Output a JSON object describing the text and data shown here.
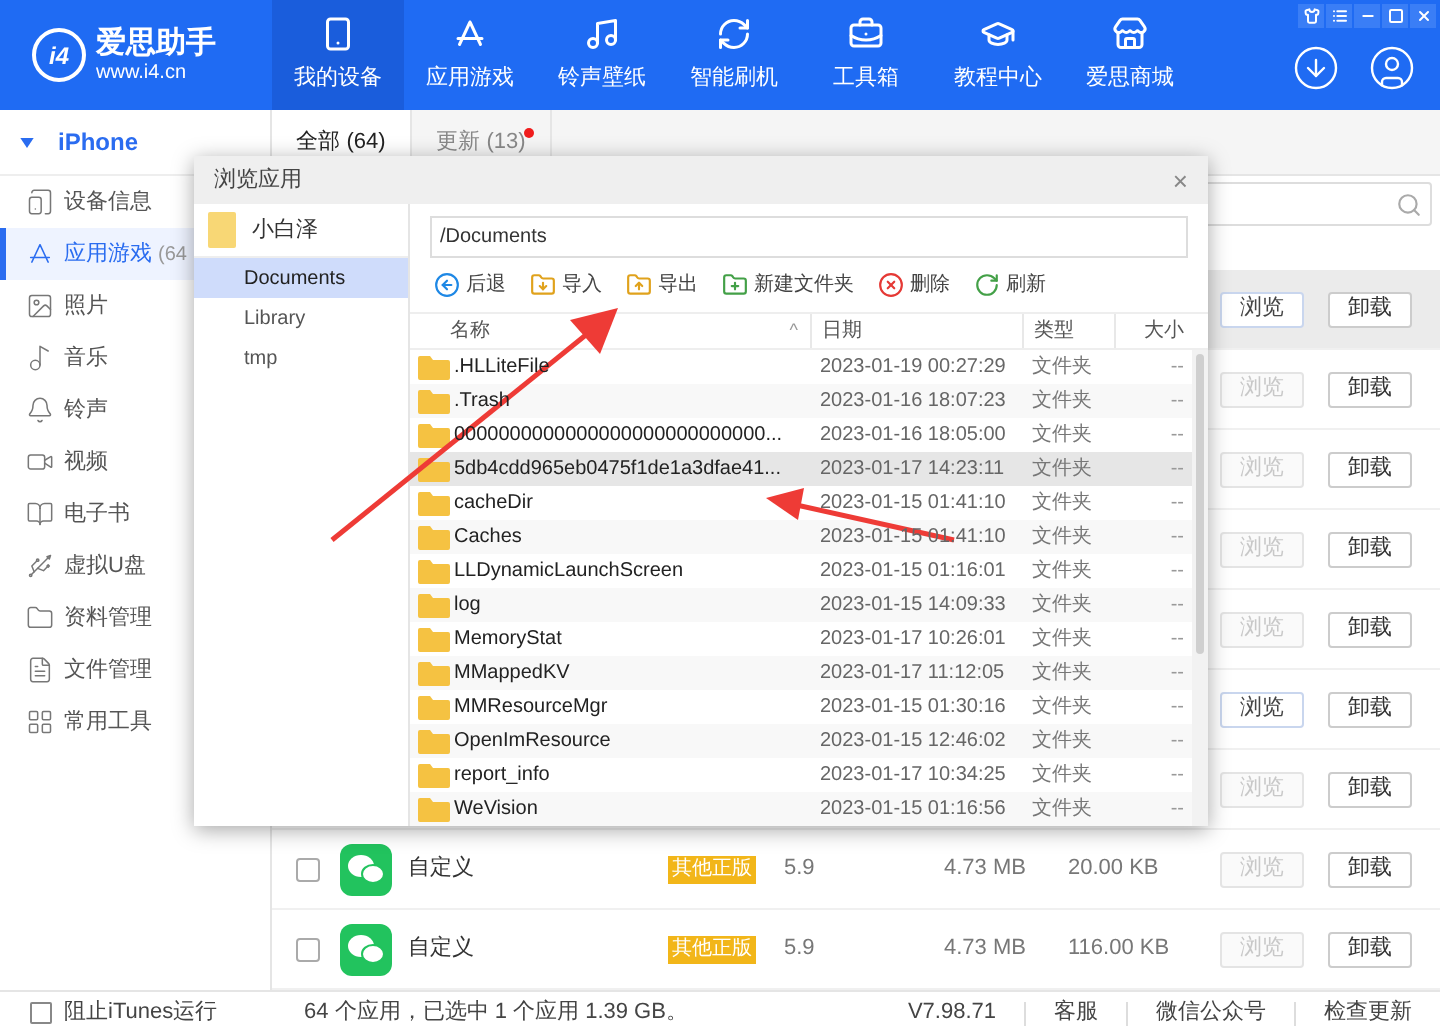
{
  "app": {
    "logo_mark": "i4",
    "logo_name": "爱思助手",
    "logo_url": "www.i4.cn"
  },
  "nav": [
    {
      "label": "我的设备",
      "selected": true
    },
    {
      "label": "应用游戏",
      "selected": false
    },
    {
      "label": "铃声壁纸",
      "selected": false
    },
    {
      "label": "智能刷机",
      "selected": false
    },
    {
      "label": "工具箱",
      "selected": false
    },
    {
      "label": "教程中心",
      "selected": false
    },
    {
      "label": "爱思商城",
      "selected": false
    }
  ],
  "sidebar": {
    "device": "iPhone",
    "expanded": true,
    "items": [
      {
        "label": "设备信息",
        "selected": false
      },
      {
        "label": "应用游戏",
        "count": "(64",
        "selected": true
      },
      {
        "label": "照片",
        "selected": false
      },
      {
        "label": "音乐",
        "selected": false
      },
      {
        "label": "铃声",
        "selected": false
      },
      {
        "label": "视频",
        "selected": false
      },
      {
        "label": "电子书",
        "selected": false
      },
      {
        "label": "虚拟U盘",
        "selected": false
      },
      {
        "label": "资料管理",
        "selected": false
      },
      {
        "label": "文件管理",
        "selected": false
      },
      {
        "label": "常用工具",
        "selected": false
      }
    ]
  },
  "tabs": [
    {
      "label": "全部 (64)",
      "selected": true,
      "new_dot": false
    },
    {
      "label": "更新 (13)",
      "selected": false,
      "new_dot": true
    }
  ],
  "apps": [
    {
      "selected": true,
      "preview": {
        "label": "浏览",
        "disabled": false
      },
      "uninstall": "卸载"
    },
    {
      "selected": false,
      "preview": {
        "label": "浏览",
        "disabled": true
      },
      "uninstall": "卸载"
    },
    {
      "selected": false,
      "preview": {
        "label": "浏览",
        "disabled": true
      },
      "uninstall": "卸载"
    },
    {
      "selected": false,
      "preview": {
        "label": "浏览",
        "disabled": true
      },
      "uninstall": "卸载"
    },
    {
      "selected": false,
      "preview": {
        "label": "浏览",
        "disabled": true
      },
      "uninstall": "卸载"
    },
    {
      "selected": false,
      "preview": {
        "label": "浏览",
        "disabled": false
      },
      "uninstall": "卸载"
    },
    {
      "selected": false,
      "preview": {
        "label": "浏览",
        "disabled": true
      },
      "uninstall": "卸载"
    },
    {
      "selected": false,
      "checked": false,
      "name": "自定义",
      "badge": "其他正版",
      "version": "5.9",
      "size": "4.73 MB",
      "data": "20.00 KB",
      "preview": {
        "label": "浏览",
        "disabled": true
      },
      "uninstall": "卸载"
    },
    {
      "selected": false,
      "checked": false,
      "name": "自定义",
      "badge": "其他正版",
      "version": "5.9",
      "size": "4.73 MB",
      "data": "116.00 KB",
      "preview": {
        "label": "浏览",
        "disabled": true
      },
      "uninstall": "卸载"
    }
  ],
  "dialog": {
    "title": "浏览应用",
    "close": "×",
    "root_folder": "小白泽",
    "folders": [
      {
        "label": "Documents",
        "selected": true
      },
      {
        "label": "Library",
        "selected": false
      },
      {
        "label": "tmp",
        "selected": false
      }
    ],
    "path": "/Documents",
    "toolbar": [
      "后退",
      "导入",
      "导出",
      "新建文件夹",
      "删除",
      "刷新"
    ],
    "columns": [
      {
        "label": "名称",
        "sort": "^"
      },
      {
        "label": "日期"
      },
      {
        "label": "类型"
      },
      {
        "label": "大小"
      }
    ],
    "rows": [
      {
        "name": ".HLLiteFile",
        "date": "2023-01-19 00:27:29",
        "type": "文件夹",
        "size": "--",
        "selected": false
      },
      {
        "name": ".Trash",
        "date": "2023-01-16 18:07:23",
        "type": "文件夹",
        "size": "--",
        "selected": false
      },
      {
        "name": "0000000000000000000000000000...",
        "date": "2023-01-16 18:05:00",
        "type": "文件夹",
        "size": "--",
        "selected": false
      },
      {
        "name": "5db4cdd965eb0475f1de1a3dfae41...",
        "date": "2023-01-17 14:23:11",
        "type": "文件夹",
        "size": "--",
        "selected": true
      },
      {
        "name": "cacheDir",
        "date": "2023-01-15 01:41:10",
        "type": "文件夹",
        "size": "--",
        "selected": false
      },
      {
        "name": "Caches",
        "date": "2023-01-15 01:41:10",
        "type": "文件夹",
        "size": "--",
        "selected": false
      },
      {
        "name": "LLDynamicLaunchScreen",
        "date": "2023-01-15 01:16:01",
        "type": "文件夹",
        "size": "--",
        "selected": false
      },
      {
        "name": "log",
        "date": "2023-01-15 14:09:33",
        "type": "文件夹",
        "size": "--",
        "selected": false
      },
      {
        "name": "MemoryStat",
        "date": "2023-01-17 10:26:01",
        "type": "文件夹",
        "size": "--",
        "selected": false
      },
      {
        "name": "MMappedKV",
        "date": "2023-01-17 11:12:05",
        "type": "文件夹",
        "size": "--",
        "selected": false
      },
      {
        "name": "MMResourceMgr",
        "date": "2023-01-15 01:30:16",
        "type": "文件夹",
        "size": "--",
        "selected": false
      },
      {
        "name": "OpenImResource",
        "date": "2023-01-15 12:46:02",
        "type": "文件夹",
        "size": "--",
        "selected": false
      },
      {
        "name": "report_info",
        "date": "2023-01-17 10:34:25",
        "type": "文件夹",
        "size": "--",
        "selected": false
      },
      {
        "name": "WeVision",
        "date": "2023-01-15 01:16:56",
        "type": "文件夹",
        "size": "--",
        "selected": false
      }
    ]
  },
  "status_bar": {
    "block_itunes": {
      "label": "阻止iTunes运行",
      "checked": false
    },
    "summary": "64 个应用，已选中 1 个应用 1.39 GB。",
    "links": [
      "V7.98.71",
      "客服",
      "微信公众号",
      "检查更新"
    ]
  }
}
